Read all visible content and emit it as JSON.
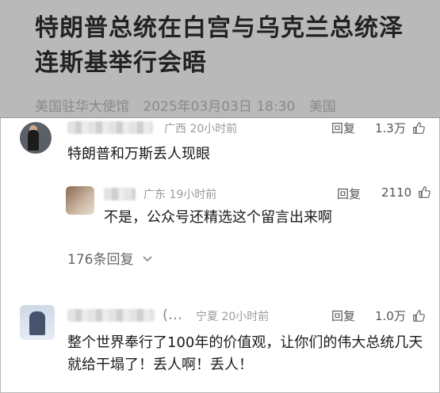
{
  "article": {
    "title": "特朗普总统在白宫与乌克兰总统泽连斯基举行会晤",
    "source": "美国驻华大使馆",
    "datetime": "2025年03月03日 18:30",
    "region": "美国"
  },
  "comments": [
    {
      "location_time": "广西 20小时前",
      "reply_label": "回复",
      "likes": "1.3万",
      "text": "特朗普和万斯丢人现眼",
      "replies": [
        {
          "location_time": "广东 19小时前",
          "reply_label": "回复",
          "likes": "2110",
          "text": "不是，公众号还精选这个留言出来啊"
        }
      ],
      "more_replies_label": "176条回复"
    },
    {
      "name_partial": "(…",
      "location_time": "宁夏 20小时前",
      "reply_label": "回复",
      "likes": "1.0万",
      "text": "整个世界奉行了100年的价值观，让你们的伟大总统几天就给干塌了！丢人啊！丢人！"
    }
  ],
  "icons": {
    "like": "thumbs-up-icon",
    "expand": "chevron-down-icon"
  }
}
